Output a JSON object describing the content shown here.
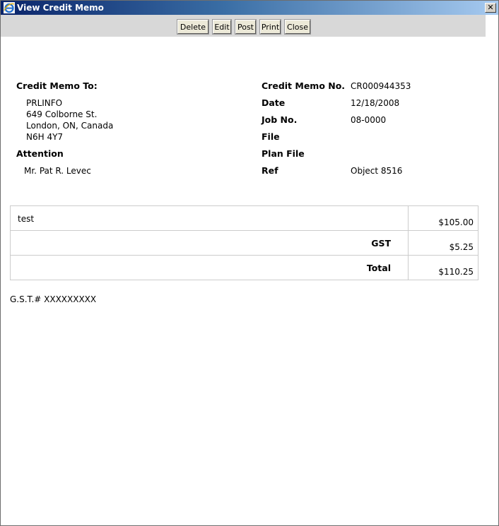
{
  "window": {
    "title": "View Credit Memo",
    "close_glyph": "✕",
    "icon": "ie-icon"
  },
  "toolbar": {
    "delete_label": "Delete",
    "edit_label": "Edit",
    "post_label": "Post",
    "print_label": "Print",
    "close_label": "Close"
  },
  "bill_to": {
    "heading": "Credit Memo To:",
    "company": "PRLINFO",
    "street": "649 Colborne St.",
    "city": "London, ON, Canada",
    "postal": "N6H 4Y7",
    "attention_label": "Attention",
    "attention_name": "Mr. Pat R. Levec"
  },
  "details": {
    "memo_no_label": "Credit Memo No.",
    "memo_no": "CR000944353",
    "date_label": "Date",
    "date": "12/18/2008",
    "job_label": "Job No.",
    "job": "08-0000",
    "file_label": "File",
    "file": "",
    "plan_file_label": "Plan File",
    "plan_file": "",
    "ref_label": "Ref",
    "ref": "Object 8516"
  },
  "items": {
    "description": "test",
    "line_amount": "$105.00",
    "gst_label": "GST",
    "gst_amount": "$5.25",
    "total_label": "Total",
    "total_amount": "$110.25"
  },
  "footer": {
    "gst_number": "G.S.T.# XXXXXXXXX"
  }
}
